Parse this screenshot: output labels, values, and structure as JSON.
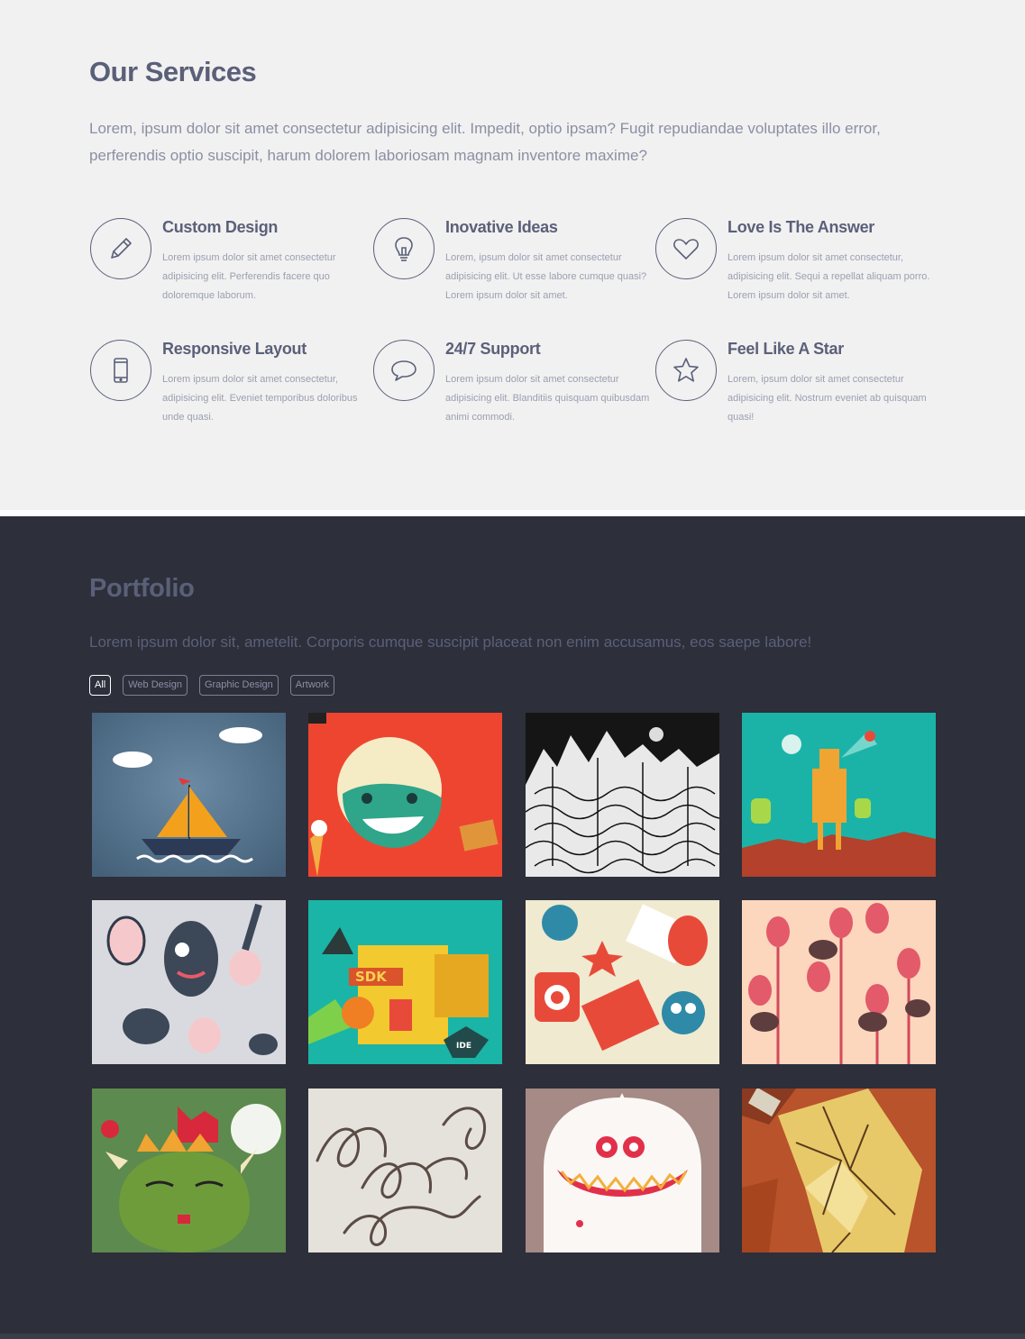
{
  "services": {
    "title": "Our Services",
    "intro": "Lorem, ipsum dolor sit amet consectetur adipisicing elit. Impedit, optio ipsam? Fugit repudiandae voluptates illo error, perferendis optio suscipit, harum dolorem laboriosam magnam inventore maxime?",
    "items": [
      {
        "icon": "pencil-icon",
        "title": "Custom Design",
        "text": "Lorem ipsum dolor sit amet consectetur adipisicing elit. Perferendis facere quo doloremque laborum."
      },
      {
        "icon": "lightbulb-icon",
        "title": "Inovative Ideas",
        "text": "Lorem, ipsum dolor sit amet consectetur adipisicing elit. Ut esse labore cumque quasi? Lorem ipsum dolor sit amet."
      },
      {
        "icon": "heart-icon",
        "title": "Love Is The Answer",
        "text": "Lorem ipsum dolor sit amet consectetur, adipisicing elit. Sequi a repellat aliquam porro. Lorem ipsum dolor sit amet."
      },
      {
        "icon": "mobile-phone-icon",
        "title": "Responsive Layout",
        "text": "Lorem ipsum dolor sit amet consectetur, adipisicing elit. Eveniet temporibus doloribus unde quasi."
      },
      {
        "icon": "speech-bubble-icon",
        "title": "24/7 Support",
        "text": "Lorem ipsum dolor sit amet consectetur adipisicing elit. Blanditiis quisquam quibusdam animi commodi."
      },
      {
        "icon": "star-icon",
        "title": "Feel Like A Star",
        "text": "Lorem, ipsum dolor sit amet consectetur adipisicing elit. Nostrum eveniet ab quisquam quasi!"
      }
    ]
  },
  "portfolio": {
    "title": "Portfolio",
    "intro": "Lorem ipsum dolor sit, ametelit. Corporis cumque suscipit placeat non enim accusamus, eos saepe labore!",
    "filters": [
      {
        "label": "All",
        "active": true
      },
      {
        "label": "Web Design",
        "active": false
      },
      {
        "label": "Graphic Design",
        "active": false
      },
      {
        "label": "Artwork",
        "active": false
      }
    ],
    "tiles": [
      {
        "name": "sailboat-illustration"
      },
      {
        "name": "girl-icecream-illustration"
      },
      {
        "name": "city-lineart-illustration"
      },
      {
        "name": "robot-illustration"
      },
      {
        "name": "monsters-pattern-illustration"
      },
      {
        "name": "sdk-city-illustration"
      },
      {
        "name": "robots-pattern-illustration"
      },
      {
        "name": "birds-eggs-illustration"
      },
      {
        "name": "monster-castle-illustration"
      },
      {
        "name": "ribbon-lettering-illustration"
      },
      {
        "name": "white-monster-illustration"
      },
      {
        "name": "broken-glass-illustration"
      }
    ]
  },
  "colors": {
    "services_bg": "#f1f1f1",
    "portfolio_bg": "#2d2f3b",
    "heading": "#5b6079",
    "body_text": "#8b8fa3"
  }
}
